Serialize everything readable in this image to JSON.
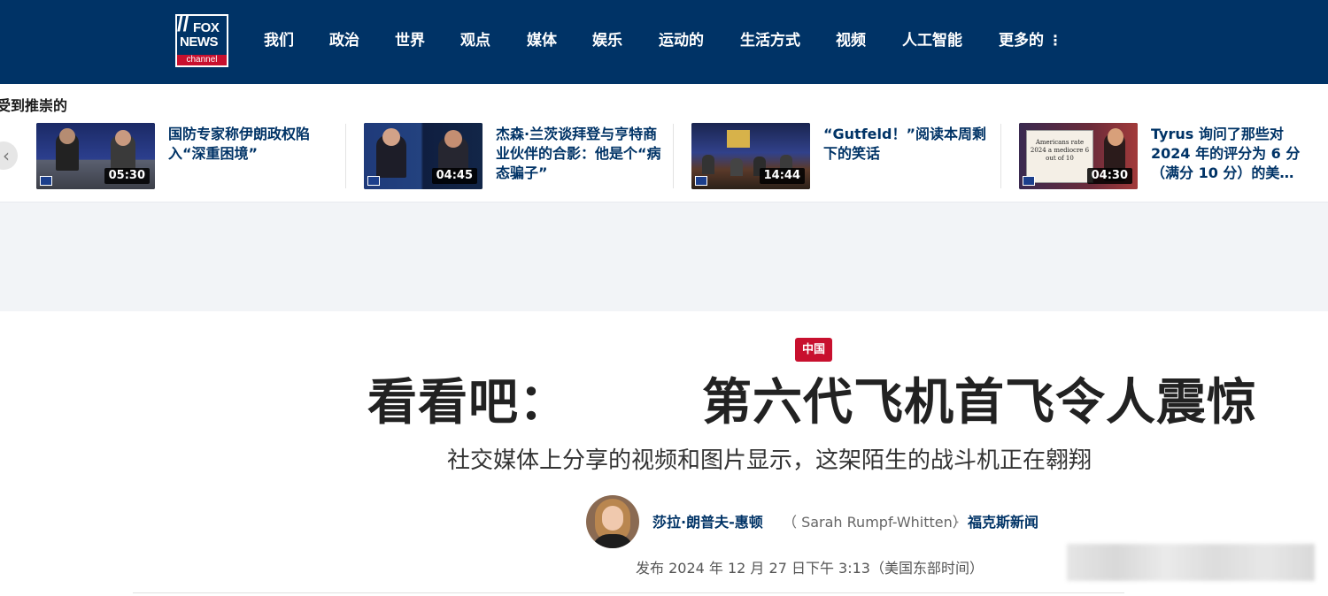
{
  "logo": {
    "line1": "FOX",
    "line2": "NEWS",
    "line3": "channel"
  },
  "nav": {
    "items": [
      "我们",
      "政治",
      "世界",
      "观点",
      "媒体",
      "娱乐",
      "运动的",
      "生活方式",
      "视频",
      "人工智能",
      "更多的"
    ],
    "more_icon": "⋮"
  },
  "recommended": {
    "title": "受到推崇的",
    "prev_icon": "chevron-left-icon",
    "cards": [
      {
        "title": "国防专家称伊朗政权陷入“深重困境”",
        "duration": "05:30"
      },
      {
        "title": "杰森·兰茨谈拜登与亨特商业伙伴的合影：他是个“病态骗子”",
        "duration": "04:45"
      },
      {
        "title": "“Gutfeld！”阅读本周剩下的笑话",
        "duration": "14:44"
      },
      {
        "title": "Tyrus 询问了那些对 2024 年的评分为 6 分（满分 10 分）的美…",
        "duration": "04:30",
        "thumb_text": "Americans rate 2024 a mediocre 6 out of 10"
      }
    ]
  },
  "article": {
    "category": "中国",
    "headline_a": "看看吧：",
    "headline_b": "第六代飞机首飞令人震惊",
    "subhead": "社交媒体上分享的视频和图片显示，这架陌生的战斗机正在翱翔",
    "author": "莎拉·朗普夫-惠顿",
    "author_en": "（ Sarah Rumpf-Whitten）",
    "dot": "·",
    "source": "福克斯新闻",
    "published": "发布 2024 年 12 月 27 日下午 3:13（美国东部时间）"
  },
  "colors": {
    "header": "#003366",
    "accent": "#c8102e",
    "link": "#003366"
  }
}
